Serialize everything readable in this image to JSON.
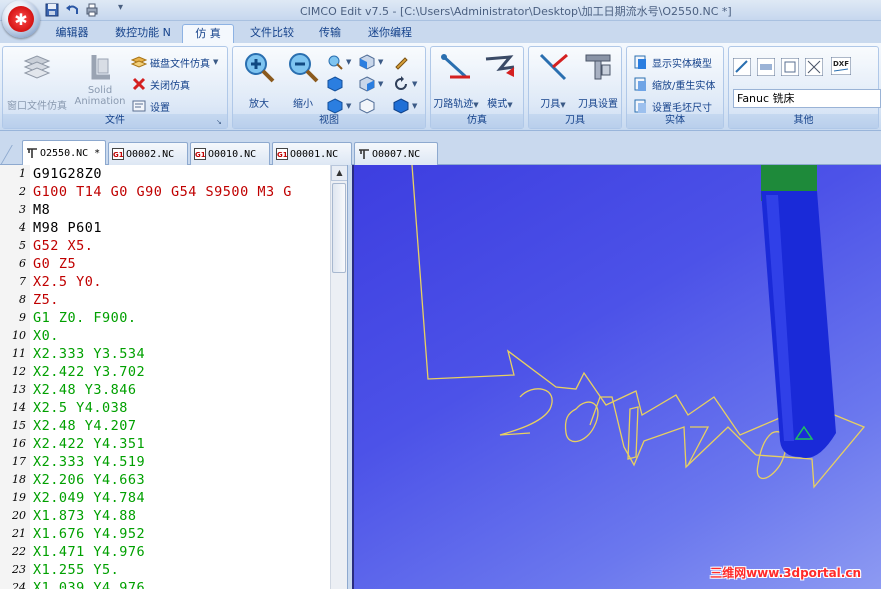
{
  "titlebar": {
    "title": "CIMCO Edit v7.5 - [C:\\Users\\Administrator\\Desktop\\加工日期流水号\\O2550.NC *]"
  },
  "menu": {
    "tabs": [
      {
        "label": "编辑器"
      },
      {
        "label": "数控功能 N"
      },
      {
        "label": "仿 真"
      },
      {
        "label": "文件比较"
      },
      {
        "label": "传输"
      },
      {
        "label": "迷你编程"
      }
    ]
  },
  "ribbon": {
    "file_group": {
      "label": "文件",
      "window_sim": "窗口文件仿真",
      "solid_animation_1": "Solid",
      "solid_animation_2": "Animation",
      "disk_sim": "磁盘文件仿真",
      "close_sim": "关闭仿真",
      "settings": "设置"
    },
    "view_group": {
      "label": "视图",
      "zoom_in": "放大",
      "zoom_out": "缩小"
    },
    "sim_group": {
      "label": "仿真",
      "toolpath": "刀路轨迹",
      "mode": "模式"
    },
    "tool_group": {
      "label": "刀具",
      "tool": "刀具",
      "tool_setup": "刀具设置"
    },
    "solid_group": {
      "label": "实体",
      "show_solid": "显示实体模型",
      "zoom_regen": "缩放/重生实体",
      "stock_size": "设置毛坯尺寸"
    },
    "other_group": {
      "label": "其他",
      "machine": "Fanuc 铣床",
      "dxf": "DXF"
    }
  },
  "doc_tabs": [
    {
      "label": "O2550.NC *",
      "active": true,
      "icon": "mill-icon"
    },
    {
      "label": "O0002.NC",
      "active": false,
      "icon": "g1-icon"
    },
    {
      "label": "O0010.NC",
      "active": false,
      "icon": "g1-icon"
    },
    {
      "label": "O0001.NC",
      "active": false,
      "icon": "g1-icon"
    },
    {
      "label": "O0007.NC",
      "active": false,
      "icon": "mill-icon"
    }
  ],
  "editor": {
    "lines": [
      {
        "n": "1",
        "code": "G91G28Z0",
        "color": "black"
      },
      {
        "n": "2",
        "code": "G100 T14 G0 G90 G54 S9500 M3 G",
        "color": "red"
      },
      {
        "n": "3",
        "code": "M8",
        "color": "black"
      },
      {
        "n": "4",
        "code": "M98 P601",
        "color": "black"
      },
      {
        "n": "5",
        "code": "G52 X5.",
        "color": "red"
      },
      {
        "n": "6",
        "code": "G0 Z5",
        "color": "red"
      },
      {
        "n": "7",
        "code": "X2.5 Y0.",
        "color": "red"
      },
      {
        "n": "8",
        "code": "Z5.",
        "color": "red"
      },
      {
        "n": "9",
        "code": "G1 Z0. F900.",
        "color": "green"
      },
      {
        "n": "10",
        "code": "X0.",
        "color": "green"
      },
      {
        "n": "11",
        "code": "X2.333 Y3.534",
        "color": "green"
      },
      {
        "n": "12",
        "code": "X2.422 Y3.702",
        "color": "green"
      },
      {
        "n": "13",
        "code": "X2.48 Y3.846",
        "color": "green"
      },
      {
        "n": "14",
        "code": "X2.5 Y4.038",
        "color": "green"
      },
      {
        "n": "15",
        "code": "X2.48 Y4.207",
        "color": "green"
      },
      {
        "n": "16",
        "code": "X2.422 Y4.351",
        "color": "green"
      },
      {
        "n": "17",
        "code": "X2.333 Y4.519",
        "color": "green"
      },
      {
        "n": "18",
        "code": "X2.206 Y4.663",
        "color": "green"
      },
      {
        "n": "19",
        "code": "X2.049 Y4.784",
        "color": "green"
      },
      {
        "n": "20",
        "code": "X1.873 Y4.88",
        "color": "green"
      },
      {
        "n": "21",
        "code": "X1.676 Y4.952",
        "color": "green"
      },
      {
        "n": "22",
        "code": "X1.471 Y4.976",
        "color": "green"
      },
      {
        "n": "23",
        "code": "X1.255 Y5.",
        "color": "green"
      },
      {
        "n": "24",
        "code": "X1.039 Y4.976",
        "color": "green"
      }
    ]
  },
  "viewport": {
    "watermark": "三维网www.3dportal.cn"
  },
  "colors": {
    "code_black": "#000000",
    "code_red": "#c00000",
    "code_green": "#00a000",
    "viewport_bg": "#4c52e8",
    "toolpath": "#e8d060",
    "tool_body": "#1a2ad8",
    "tool_holder": "#1e8a3a"
  }
}
